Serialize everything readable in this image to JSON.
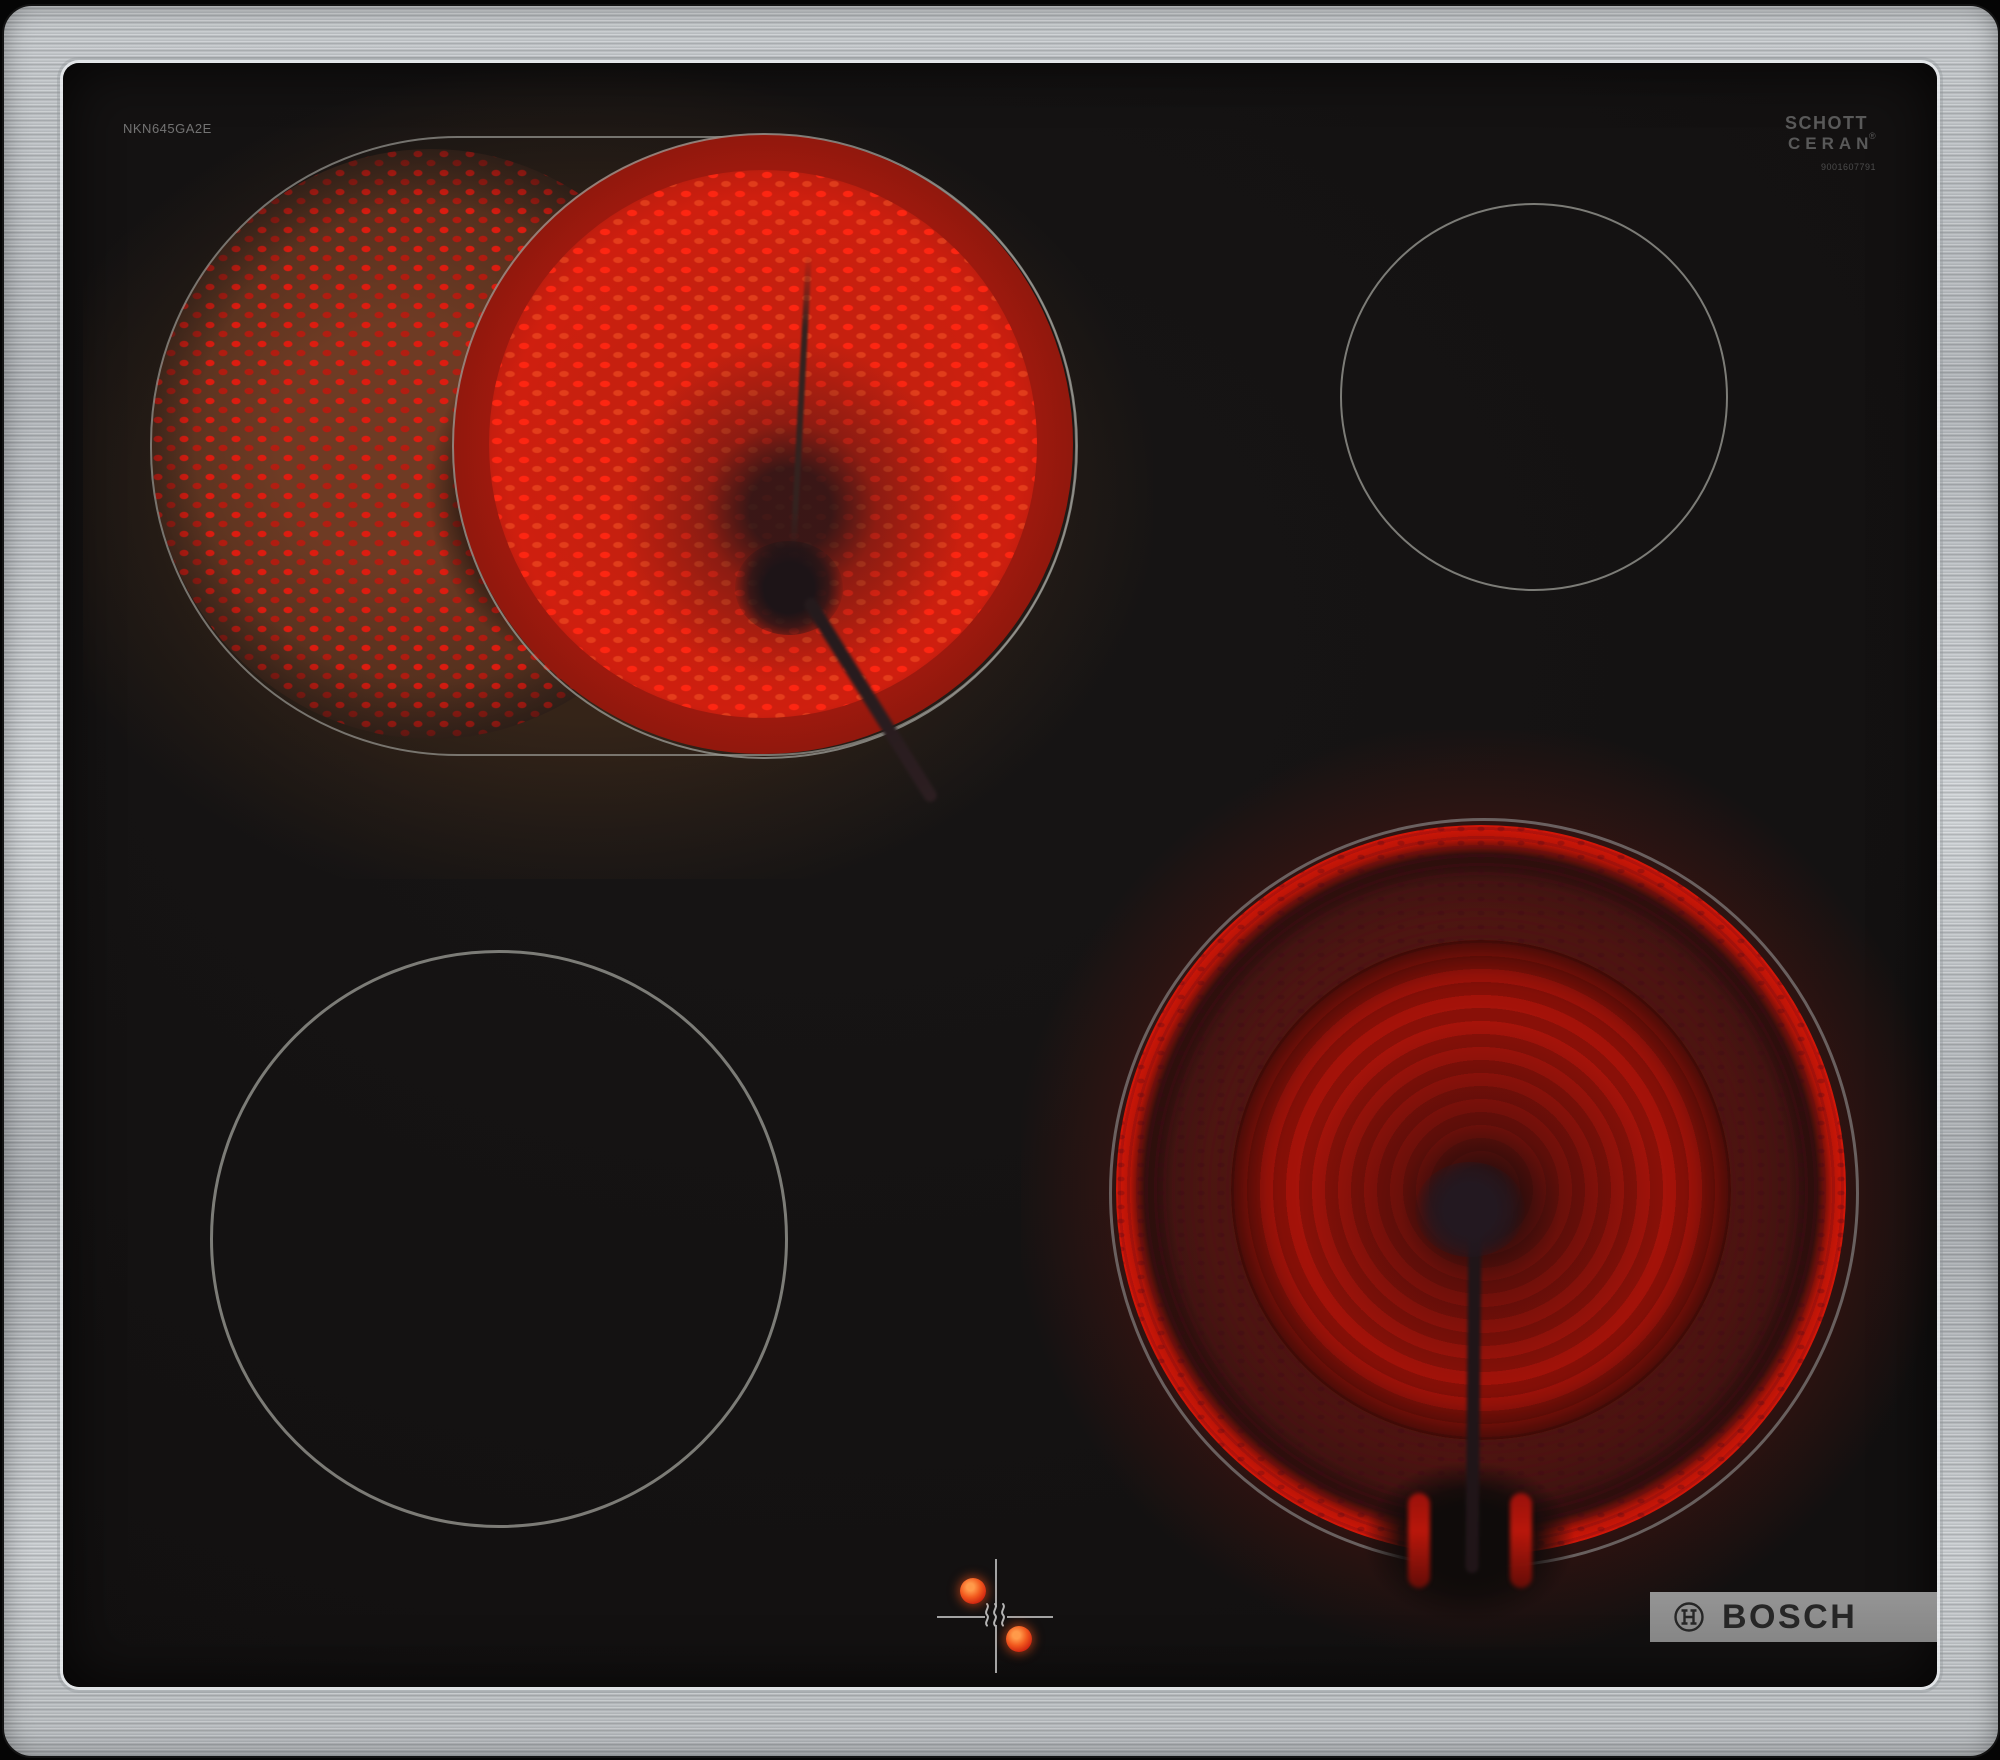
{
  "product": {
    "model_label": "NKN645GA2E",
    "glass_brand": {
      "line1": "SCHOTT",
      "line2": "CERAN",
      "registered": "®",
      "serial": "9001607791"
    },
    "brand": {
      "logo_text": "BOSCH"
    }
  },
  "surface": {
    "frame_color": "#c3c7ca",
    "glass_color": "#141212",
    "zone_outline_color": "#9a9a94",
    "glow_bright_color": "#ec1808",
    "glow_deep_color": "#8a1008",
    "ember_dull_color": "#6e3b24",
    "residual_dot_color": "#f25a1e",
    "logo_bar_color": "#8e8e8e"
  },
  "zones": [
    {
      "id": "back-left",
      "shape": "dual-oval-roaster",
      "state": "on",
      "glow": "red speckled element, left extension crescent lit"
    },
    {
      "id": "back-right",
      "shape": "circle",
      "state": "off",
      "glow": "none"
    },
    {
      "id": "front-left",
      "shape": "circle",
      "state": "off",
      "glow": "none"
    },
    {
      "id": "front-right",
      "shape": "circle",
      "state": "on",
      "glow": "bright red coil ring with dark center hub"
    }
  ],
  "indicator": {
    "type": "residual-heat-crosshair",
    "hot_dots": 2,
    "icons": {
      "heat_symbol": "residual-heat-wave-icon",
      "brand_symbol": "bosch-armature-icon"
    }
  }
}
